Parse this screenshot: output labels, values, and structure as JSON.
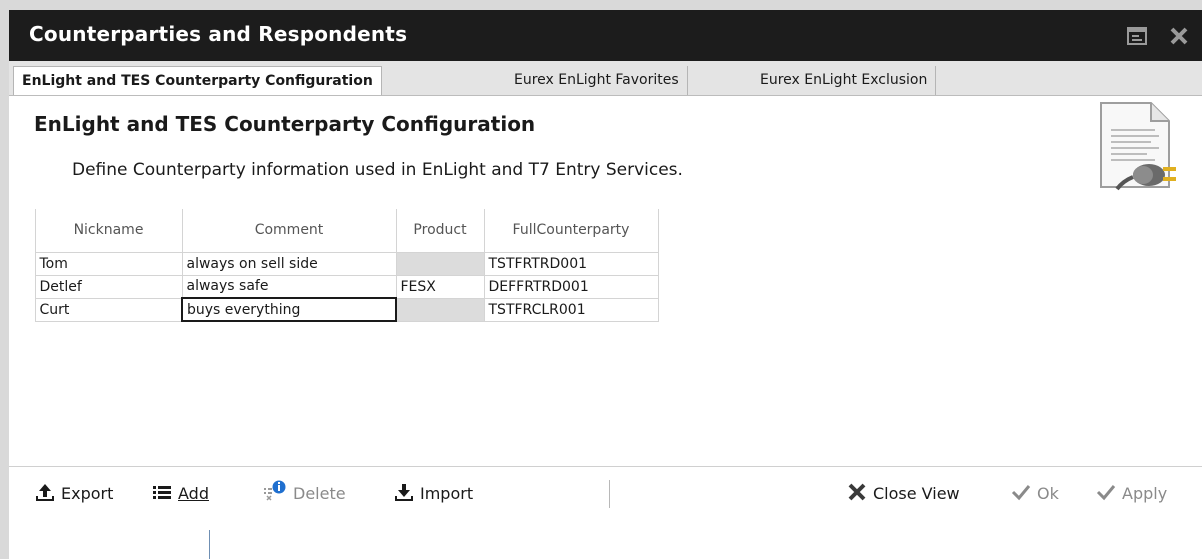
{
  "window": {
    "title": "Counterparties and Respondents"
  },
  "tabs": [
    {
      "label": "EnLight and TES Counterparty Configuration",
      "active": true
    },
    {
      "label": "Eurex EnLight Favorites",
      "active": false
    },
    {
      "label": "Eurex EnLight Exclusion",
      "active": false
    }
  ],
  "header": {
    "title": "EnLight and TES Counterparty Configuration",
    "description": "Define Counterparty information used in EnLight and T7 Entry Services."
  },
  "table": {
    "columns": [
      "Nickname",
      "Comment",
      "Product",
      "FullCounterparty"
    ],
    "rows": [
      {
        "nickname": "Tom",
        "comment": "always on sell side",
        "product": "",
        "full": "TSTFRTRD001"
      },
      {
        "nickname": "Detlef",
        "comment": "always safe",
        "product": "FESX",
        "full": "DEFFRTRD001"
      },
      {
        "nickname": "Curt",
        "comment": "buys everything",
        "product": "",
        "full": "TSTFRCLR001"
      }
    ]
  },
  "toolbar": {
    "export": "Export",
    "add": "Add",
    "delete": "Delete",
    "import": "Import",
    "close_view": "Close View",
    "ok": "Ok",
    "apply": "Apply"
  },
  "icons": {
    "window_controls": [
      "dock-icon",
      "close-icon"
    ],
    "document": "document-plug-icon",
    "export": "upload-arrow-icon",
    "add": "add-list-icon",
    "delete": "delete-list-icon",
    "import": "download-arrow-icon",
    "close_view": "close-x-icon",
    "ok": "checkmark-icon",
    "apply": "checkmark-icon"
  },
  "colors": {
    "titlebar": "#1c1c1c",
    "tabbar": "#e4e4e4",
    "disabled_text": "#8a8a8a",
    "info_blue": "#1f6fcf"
  }
}
